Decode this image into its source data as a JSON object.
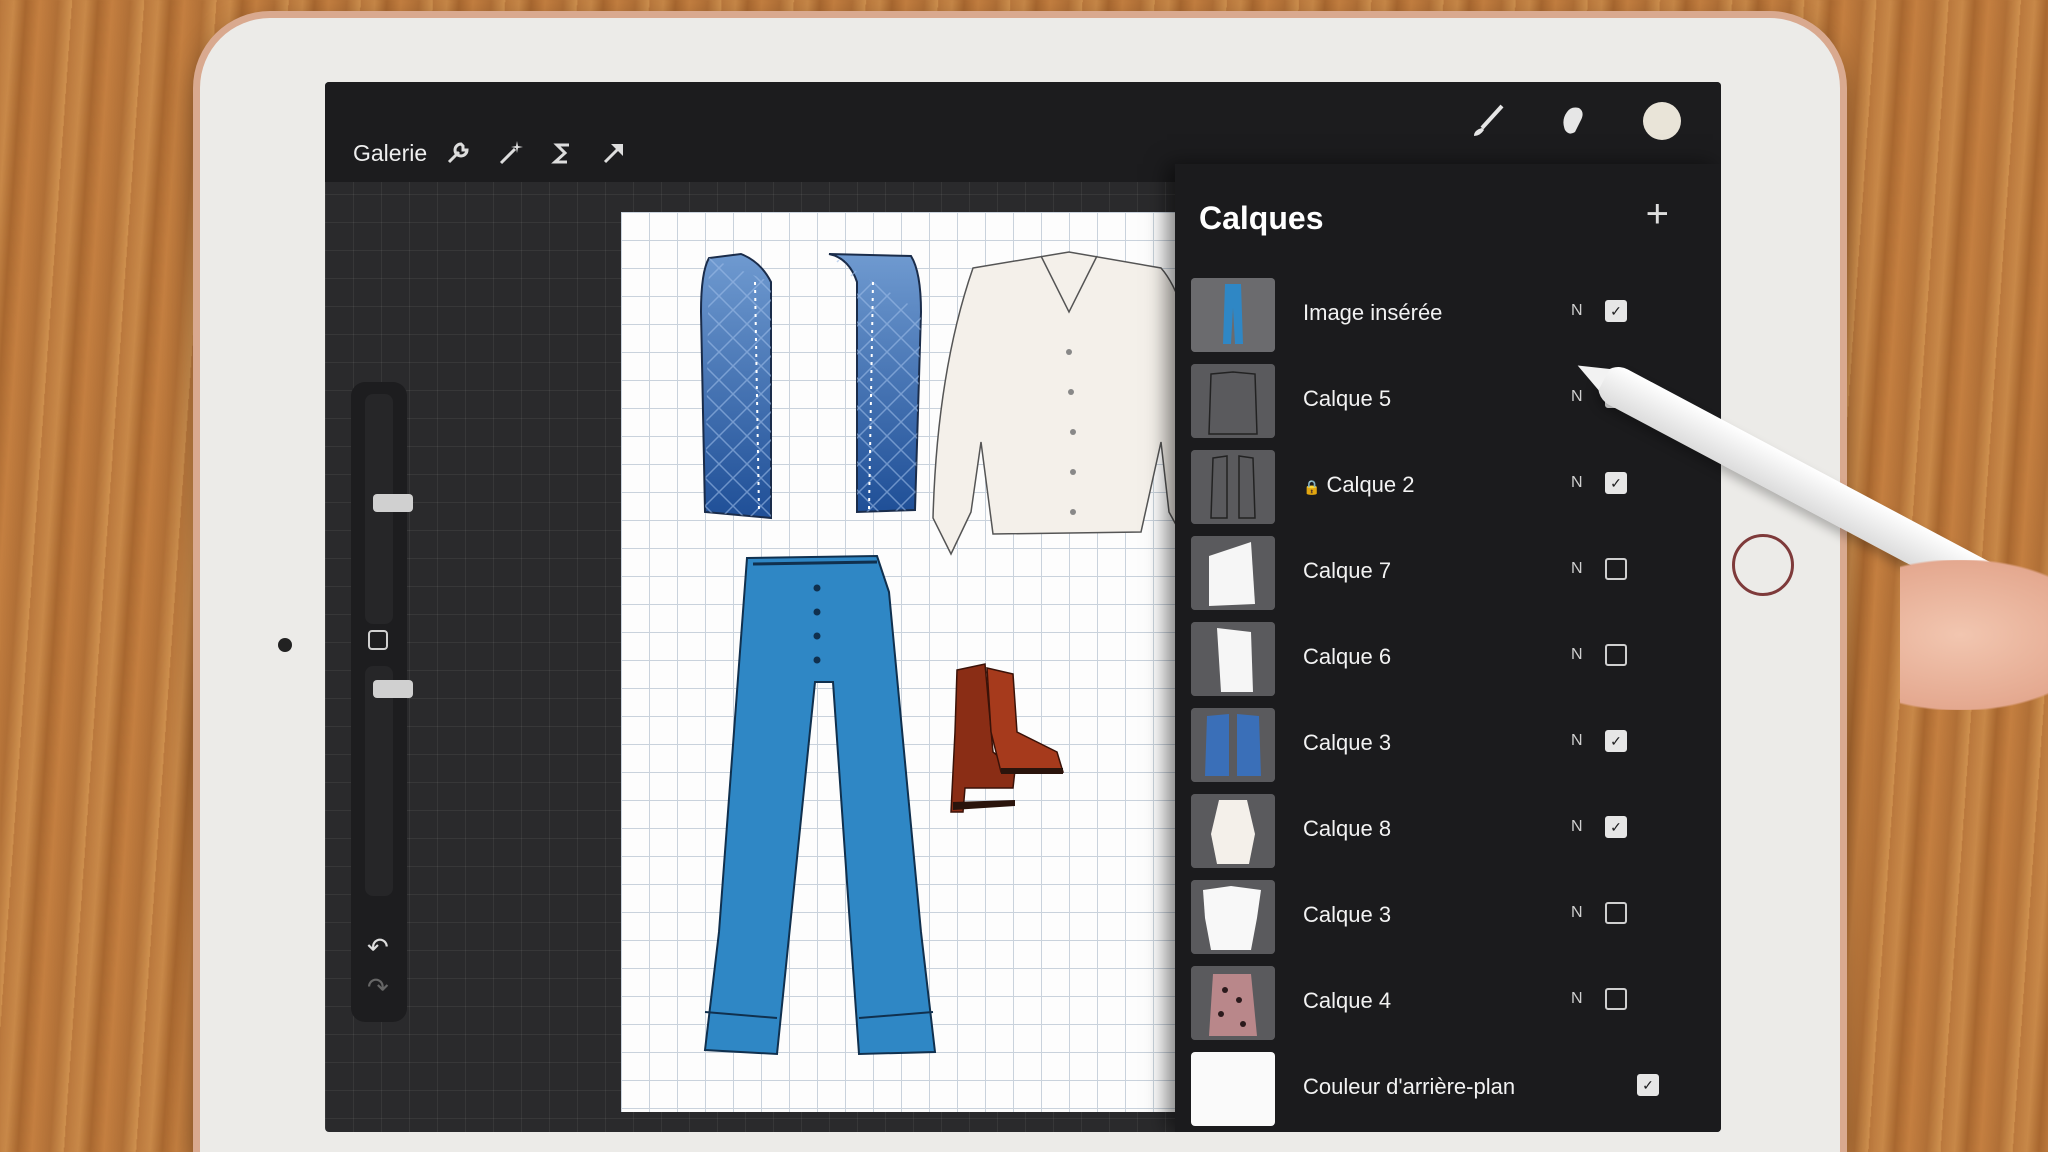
{
  "header": {
    "gallery_label": "Galerie"
  },
  "toolbar_left": [
    "wrench-icon",
    "magic-wand-icon",
    "selection-s-icon",
    "transform-arrow-icon"
  ],
  "toolbar_right": [
    "brush-icon",
    "smudge-icon",
    "eraser-icon",
    "layers-icon",
    "color-swatch"
  ],
  "accent_color": "#3b7be0",
  "swatch_color": "#e9e4d8",
  "layers_panel": {
    "title": "Calques",
    "add_label": "+",
    "items": [
      {
        "name": "Image insérée",
        "mode": "N",
        "visible": true,
        "locked": false,
        "thumb": "jeans"
      },
      {
        "name": "Calque 5",
        "mode": "N",
        "visible": true,
        "locked": false,
        "thumb": "jacket-outline"
      },
      {
        "name": "Calque 2",
        "mode": "N",
        "visible": true,
        "locked": true,
        "thumb": "vest-outline"
      },
      {
        "name": "Calque 7",
        "mode": "N",
        "visible": false,
        "locked": false,
        "thumb": "white-shape"
      },
      {
        "name": "Calque 6",
        "mode": "N",
        "visible": false,
        "locked": false,
        "thumb": "white-shape"
      },
      {
        "name": "Calque 3",
        "mode": "N",
        "visible": true,
        "locked": false,
        "thumb": "blue-vest"
      },
      {
        "name": "Calque 8",
        "mode": "N",
        "visible": true,
        "locked": false,
        "thumb": "white-blouse"
      },
      {
        "name": "Calque 3",
        "mode": "N",
        "visible": false,
        "locked": false,
        "thumb": "white-shirt"
      },
      {
        "name": "Calque 4",
        "mode": "N",
        "visible": false,
        "locked": false,
        "thumb": "floral-dress"
      },
      {
        "name": "Couleur d'arrière-plan",
        "mode": "",
        "visible": true,
        "locked": false,
        "thumb": "white-bg"
      }
    ]
  }
}
